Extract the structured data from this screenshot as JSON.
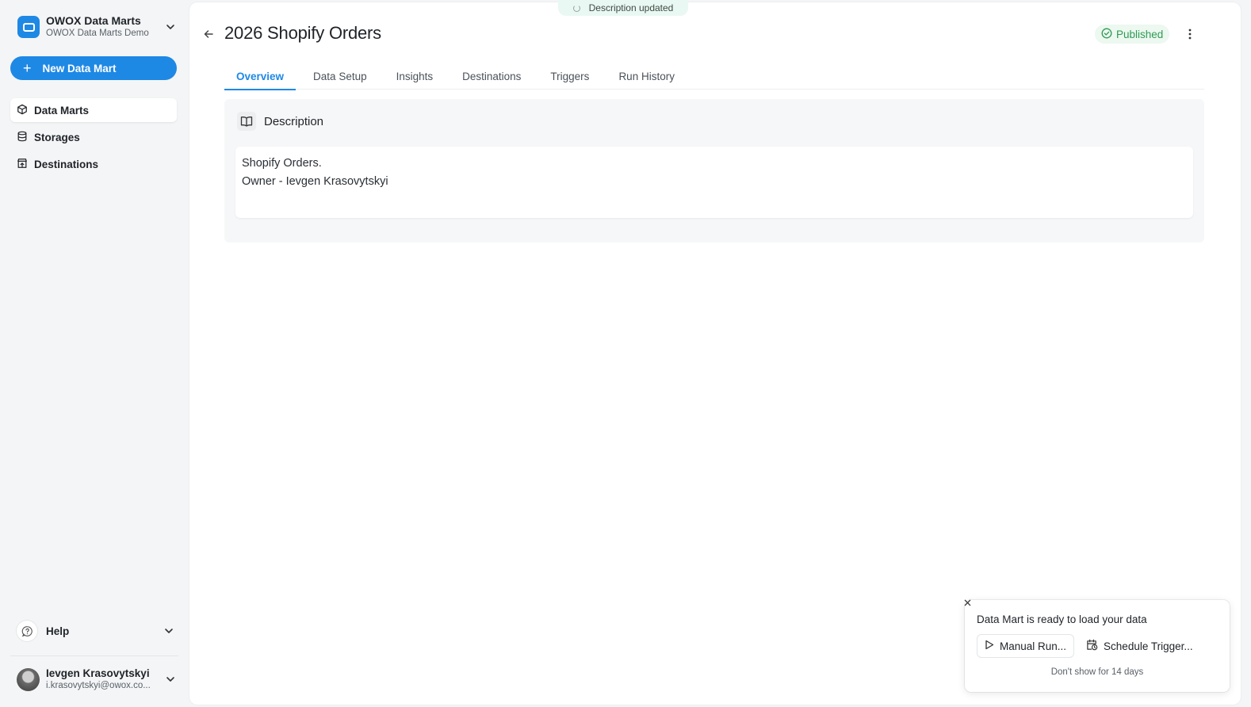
{
  "workspace": {
    "name": "OWOX Data Marts",
    "subtitle": "OWOX Data Marts Demo"
  },
  "sidebar": {
    "new_button_label": "New Data Mart",
    "items": [
      {
        "label": "Data Marts",
        "icon": "cube-icon",
        "active": true
      },
      {
        "label": "Storages",
        "icon": "database-icon",
        "active": false
      },
      {
        "label": "Destinations",
        "icon": "destination-icon",
        "active": false
      }
    ],
    "help_label": "Help",
    "user": {
      "name": "Ievgen Krasovytskyi",
      "email": "i.krasovytskyi@owox.co..."
    }
  },
  "toast": {
    "text": "Description updated"
  },
  "header": {
    "title": "2026 Shopify Orders",
    "status": "Published"
  },
  "tabs": [
    {
      "label": "Overview",
      "active": true
    },
    {
      "label": "Data Setup",
      "active": false
    },
    {
      "label": "Insights",
      "active": false
    },
    {
      "label": "Destinations",
      "active": false
    },
    {
      "label": "Triggers",
      "active": false
    },
    {
      "label": "Run History",
      "active": false
    }
  ],
  "description": {
    "title": "Description",
    "lines": [
      "Shopify Orders.",
      "Owner - Ievgen Krasovytskyi"
    ]
  },
  "popup": {
    "title": "Data Mart is ready to load your data",
    "manual_run_label": "Manual Run...",
    "schedule_label": "Schedule Trigger...",
    "dismiss_label": "Don't show for 14 days"
  },
  "colors": {
    "accent": "#1e88e5",
    "status_green": "#2e9a53",
    "toast_bg": "#e9f8f2"
  }
}
